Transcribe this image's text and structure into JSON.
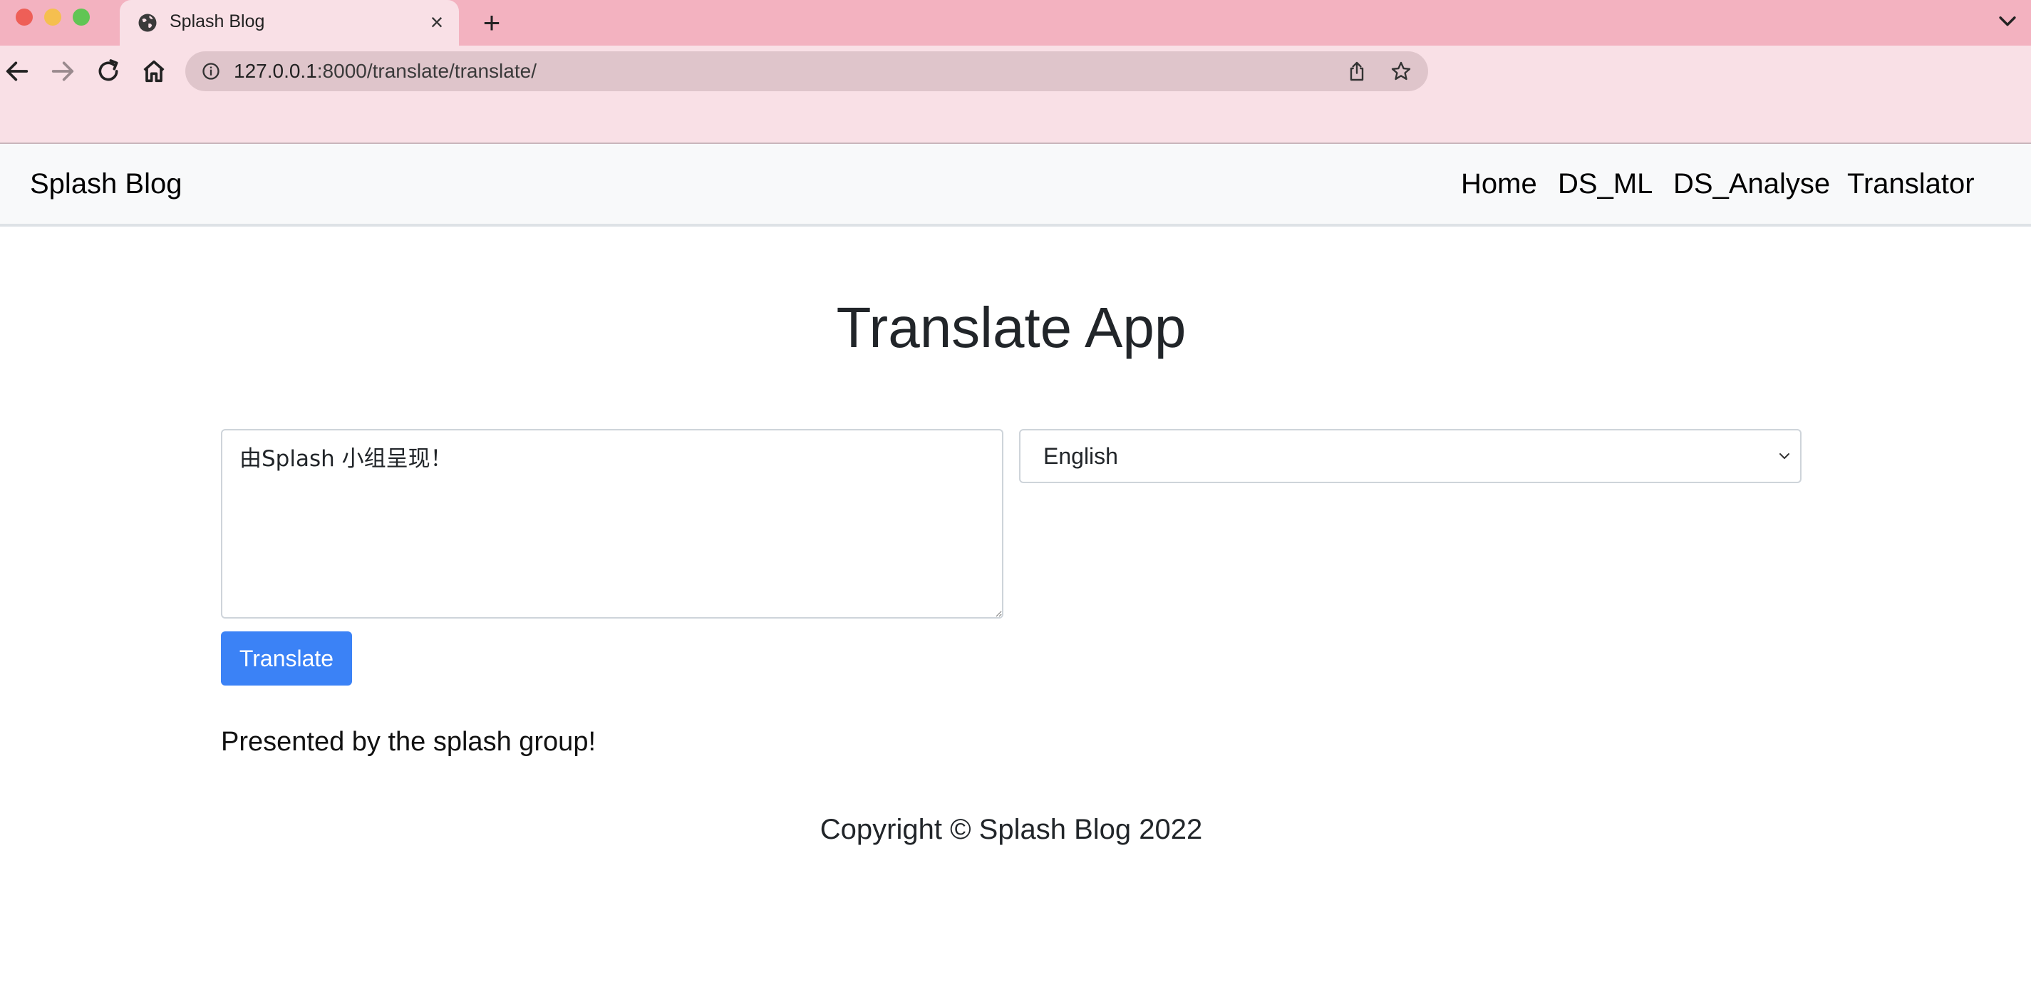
{
  "browser": {
    "tab_title": "Splash Blog",
    "url_host": "127.0.0.1",
    "url_path": ":8000/translate/translate/"
  },
  "navbar": {
    "brand": "Splash Blog",
    "links": [
      "Home",
      "DS_ML",
      "DS_Analyse",
      "Translator"
    ]
  },
  "main": {
    "title": "Translate App",
    "source_text": "由Splash 小组呈现！",
    "selected_language": "English",
    "translate_label": "Translate",
    "result": "Presented by the splash group!"
  },
  "footer": {
    "copyright": "Copyright © Splash Blog 2022"
  },
  "colors": {
    "tab_strip": "#f3b2c0",
    "chrome_bg": "#f9e0e6",
    "url_bar": "#dfc5cb",
    "navbar_bg": "#f8f9fa",
    "button_primary": "#3b82f6",
    "close_dot": "#ee5f57",
    "minimize_dot": "#f5bf4f",
    "maximize_dot": "#61c554"
  }
}
